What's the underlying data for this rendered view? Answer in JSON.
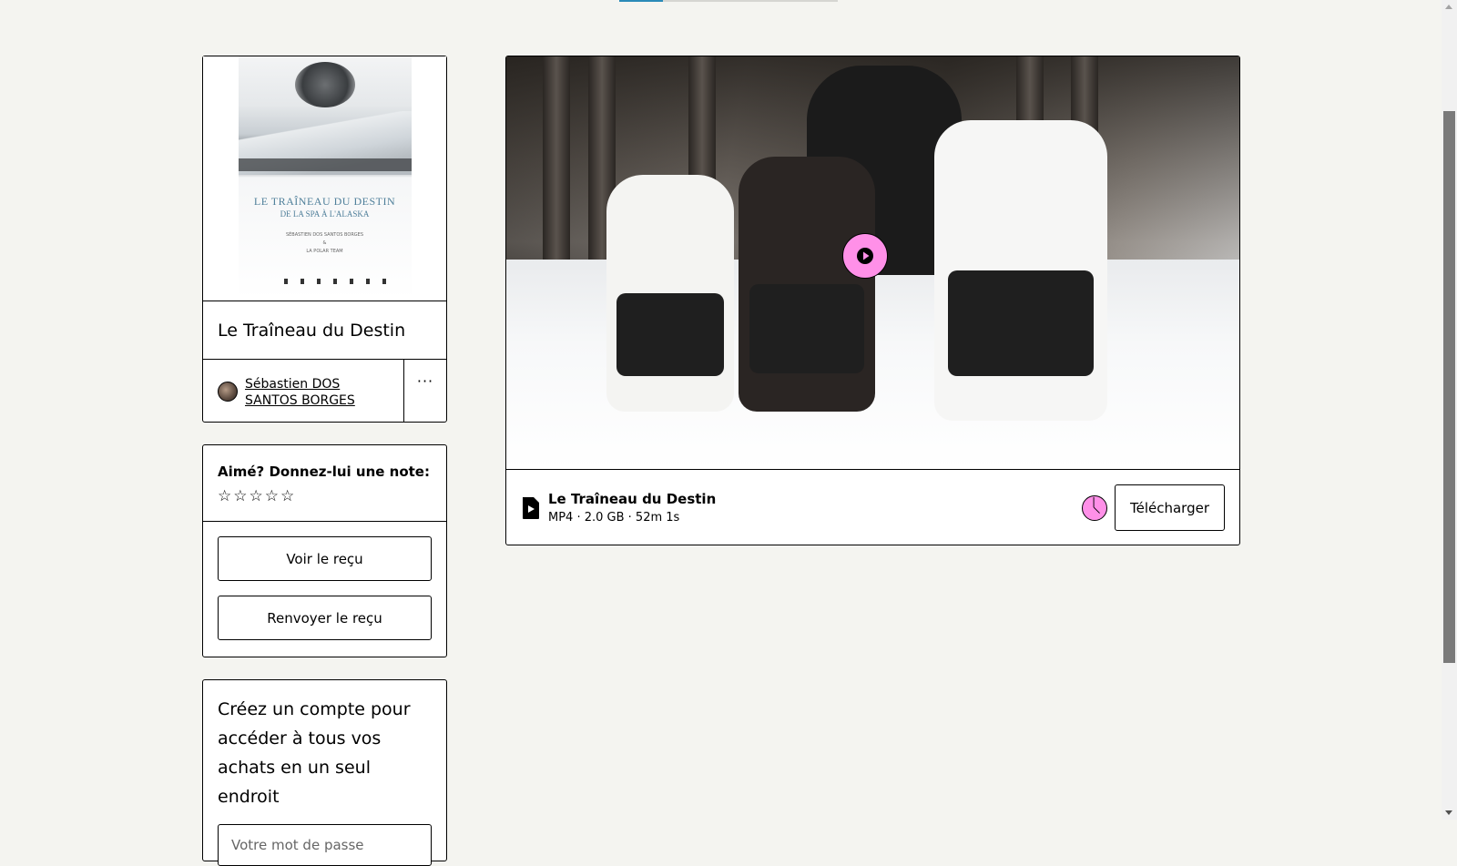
{
  "product": {
    "title": "Le Traîneau du Destin",
    "cover": {
      "title_line": "LE TRAÎNEAU DU DESTIN",
      "subtitle_line": "DE LA SPA À L'ALASKA",
      "credits": "SÉBASTIEN DOS SANTOS BORGES\n&\nLA POLAR TEAM"
    },
    "creator_name": "Sébastien DOS SANTOS BORGES",
    "more_label": "···"
  },
  "rating": {
    "label": "Aimé? Donnez-lui une note:",
    "stars": [
      "☆",
      "☆",
      "☆",
      "☆",
      "☆"
    ],
    "value": 0
  },
  "receipt": {
    "view_label": "Voir le reçu",
    "resend_label": "Renvoyer le reçu"
  },
  "account": {
    "prompt": "Créez un compte pour accéder à tous vos achats en un seul endroit",
    "password_placeholder": "Votre mot de passe"
  },
  "file": {
    "name": "Le Traîneau du Destin",
    "meta": "MP4 · 2.0 GB · 52m 1s",
    "download_label": "Télécharger",
    "icons": {
      "file": "file-video-icon",
      "play": "play-icon",
      "progress": "download-progress-icon"
    }
  },
  "colors": {
    "accent": "#ff90e8",
    "background": "#f4f4f0",
    "border": "#000000"
  }
}
